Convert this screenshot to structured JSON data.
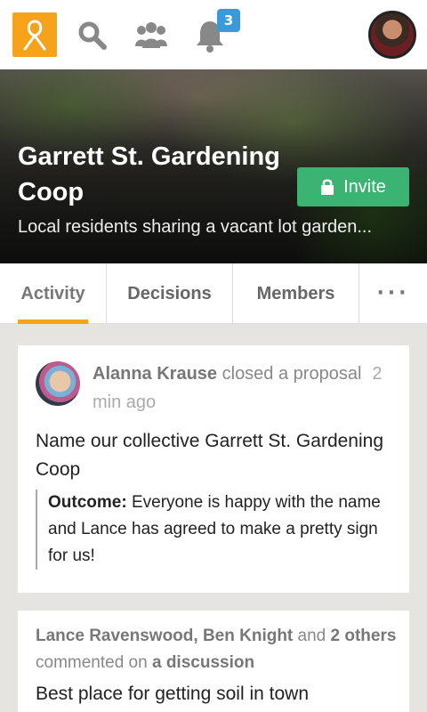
{
  "topbar": {
    "notification_count": "3",
    "colors": {
      "brand": "#f7a21b",
      "badge": "#3a9ad9",
      "icon": "#888888"
    }
  },
  "group": {
    "title": "Garrett St. Gardening Coop",
    "description": "Local residents sharing a vacant lot garden...",
    "invite_label": "Invite",
    "invite_color": "#3bb373"
  },
  "tabs": [
    {
      "label": "Activity",
      "active": true
    },
    {
      "label": "Decisions",
      "active": false
    },
    {
      "label": "Members",
      "active": false
    }
  ],
  "tab_more": "···",
  "feed": [
    {
      "actor": "Alanna Krause",
      "action_prefix": " closed a ",
      "action_object": "proposal",
      "time": "2 min ago",
      "title": "Name our collective Garrett St. Gardening Coop",
      "outcome_label": "Outcome:",
      "outcome_text": " Everyone is happy with the name and Lance has agreed to make a pretty sign for us!"
    },
    {
      "actors": "Lance Ravenswood, Ben Knight",
      "and": " and ",
      "others": "2 others",
      "action": " commented on ",
      "object": "a discussion",
      "title": "Best place for getting soil in town"
    }
  ]
}
